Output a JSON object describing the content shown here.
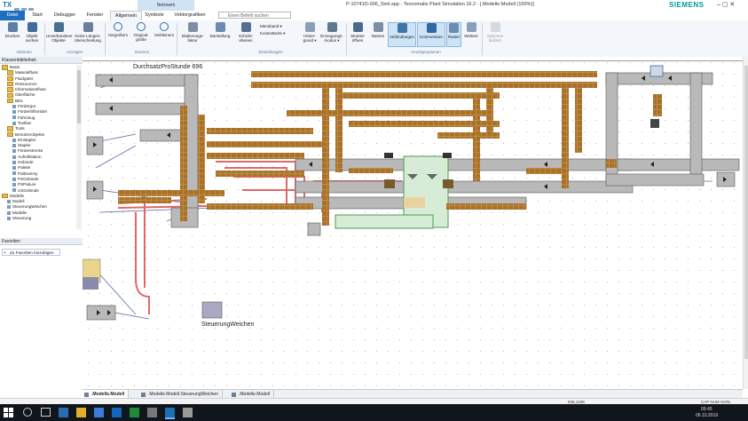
{
  "app": {
    "logo": "TX",
    "window_title": "P-10741D-006_Siml.spp - Tecnomatix Plant Simulation 16.2 - [.Modelle.Modell (150%)]",
    "brand": "SIEMENS",
    "context_tab": "Netzwerk",
    "window_controls": "–  ▢  ✕"
  },
  "ribbon_tabs": [
    "Datei",
    "Start",
    "Debugger",
    "Fenster",
    "Allgemein",
    "Symbole",
    "Vektorgrafiken"
  ],
  "command_search": {
    "placeholder": "Einen Befehl suchen"
  },
  "ribbon": {
    "groups": [
      {
        "title": "Aktionen",
        "buttons": [
          "Drucken",
          "Objekt suchen"
        ]
      },
      {
        "title": "Anzeigen",
        "buttons": [
          "Unverbundene Objekte",
          "Keine Längen- überschreitung"
        ]
      },
      {
        "title": "Zoomen",
        "buttons": [
          "Vergrößern",
          "Original- größe",
          "Verkleinern"
        ]
      },
      {
        "title": "Einstellungen",
        "buttons": [
          "Skalierungs- faktor",
          "Darstellung",
          "Schicht- ebenen"
        ],
        "stack": [
          "Menüband ▾",
          "Kontexttexte ▾",
          "Hinter- grund ▾",
          "Erzeugungs- modus ▾"
        ]
      },
      {
        "title": "Anzeigeoptionen",
        "buttons": [
          "Struktur öffnen",
          "Namen",
          "Verbindungen",
          "Kommentare",
          "Raster",
          "Weitere"
        ],
        "selected": [
          "Verbindungen",
          "Kommentare",
          "Raster"
        ]
      },
      {
        "title": "",
        "buttons": [
          "Optionen ändern"
        ]
      }
    ]
  },
  "left_panel": {
    "library_header": "Klassenbibliothek",
    "tree": [
      {
        "label": "Basis",
        "kind": "folder",
        "depth": 0
      },
      {
        "label": "Materialfluss",
        "kind": "folder",
        "depth": 1
      },
      {
        "label": "Fluidgüter",
        "kind": "folder",
        "depth": 1
      },
      {
        "label": "Ressourcen",
        "kind": "folder",
        "depth": 1
      },
      {
        "label": "Informationsfluss",
        "kind": "folder",
        "depth": 1
      },
      {
        "label": "Oberfläche",
        "kind": "folder",
        "depth": 1
      },
      {
        "label": "BEs",
        "kind": "folder",
        "depth": 1
      },
      {
        "label": "Fördergut",
        "kind": "object",
        "depth": 2
      },
      {
        "label": "Förderhilfsmittel",
        "kind": "object",
        "depth": 2
      },
      {
        "label": "Fahrzeug",
        "kind": "object",
        "depth": 2
      },
      {
        "label": "Toolbar",
        "kind": "object",
        "depth": 2
      },
      {
        "label": "Tools",
        "kind": "folder",
        "depth": 1
      },
      {
        "label": "Benutzerobjekte",
        "kind": "folder",
        "depth": 1
      },
      {
        "label": "Einstapler",
        "kind": "object",
        "depth": 2
      },
      {
        "label": "Stapler",
        "kind": "object",
        "depth": 2
      },
      {
        "label": "Förderstrecke",
        "kind": "object",
        "depth": 2
      },
      {
        "label": "Aufrollstation",
        "kind": "object",
        "depth": 2
      },
      {
        "label": "Gebinde",
        "kind": "object",
        "depth": 2
      },
      {
        "label": "Palette",
        "kind": "object",
        "depth": 2
      },
      {
        "label": "PalDummy",
        "kind": "object",
        "depth": 2
      },
      {
        "label": "PSGebinde",
        "kind": "object",
        "depth": 2
      },
      {
        "label": "PSPalLee",
        "kind": "object",
        "depth": 2
      },
      {
        "label": "USGebinde",
        "kind": "object",
        "depth": 2
      },
      {
        "label": "Modelle",
        "kind": "folder",
        "depth": 0
      },
      {
        "label": "Modell",
        "kind": "object",
        "depth": 1
      },
      {
        "label": "SteuerungWeichen",
        "kind": "object",
        "depth": 1
      },
      {
        "label": "Modelle",
        "kind": "object",
        "depth": 1
      },
      {
        "label": "Steuerung",
        "kind": "object",
        "depth": 1
      }
    ],
    "favorites_header": "Favoriten",
    "favorites_add": "Zu Favoriten hinzufügen"
  },
  "canvas": {
    "header_text": "DurchsatzProStunde 696",
    "control_label": "SteuerungWeichen",
    "colors": {
      "conveyor": "#c08a3e",
      "tracks": "#e57373",
      "belt": "#b9b9b9",
      "highlight": "#4f9a4f"
    }
  },
  "document_tabs": [
    {
      "label": ".Modelle.Modell",
      "active": true
    },
    {
      "label": ".Modelle.Modell.SteuerungWeichen",
      "active": false
    },
    {
      "label": ".Modelle.Modell",
      "active": false
    }
  ],
  "statusbar": {
    "coords": "936,1238",
    "mode": "CAP NUM SCRL"
  },
  "taskbar": {
    "time": "09:45",
    "date": "06.10.2019"
  }
}
